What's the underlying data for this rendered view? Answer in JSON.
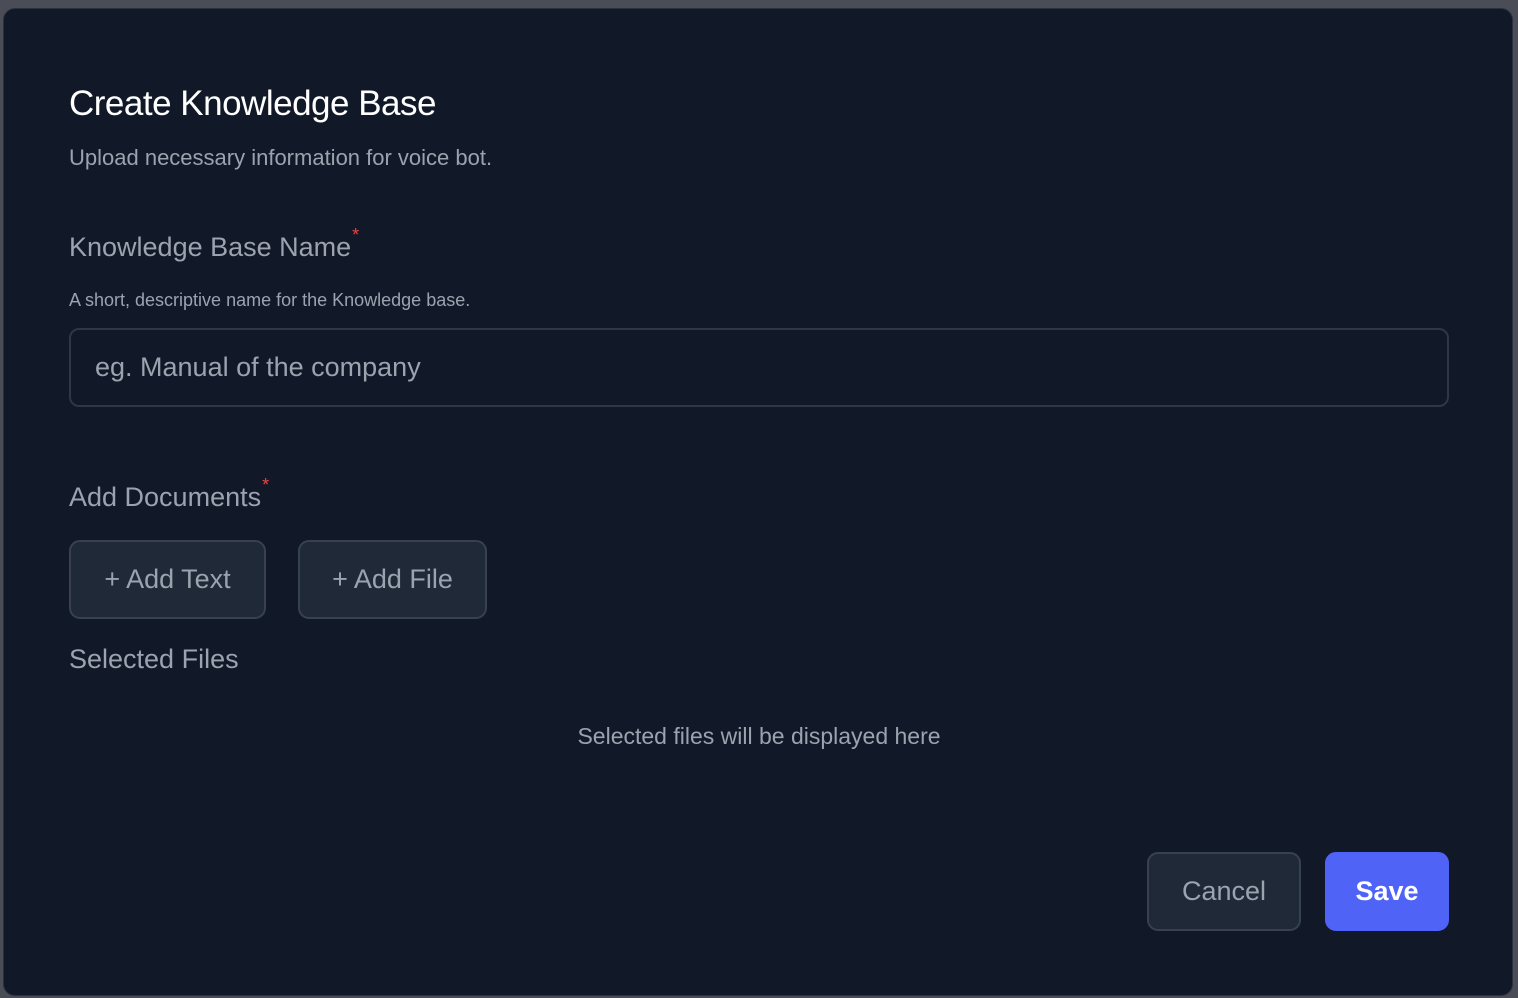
{
  "dialog": {
    "title": "Create Knowledge Base",
    "subtitle": "Upload necessary information for voice bot."
  },
  "kb_name": {
    "label": "Knowledge Base Name",
    "required_mark": "*",
    "hint": "A short, descriptive name for the Knowledge base.",
    "placeholder": "eg. Manual of the company",
    "value": ""
  },
  "documents": {
    "label": "Add Documents",
    "required_mark": "*",
    "add_text_label": "Add Text",
    "add_file_label": "Add File",
    "plus_glyph": "+"
  },
  "selected_files": {
    "title": "Selected Files",
    "empty_message": "Selected files will be displayed here"
  },
  "footer": {
    "cancel_label": "Cancel",
    "save_label": "Save"
  },
  "colors": {
    "background": "#111827",
    "accent": "#4f63f7",
    "required": "#ef4444",
    "muted_text": "#9ca3af"
  }
}
